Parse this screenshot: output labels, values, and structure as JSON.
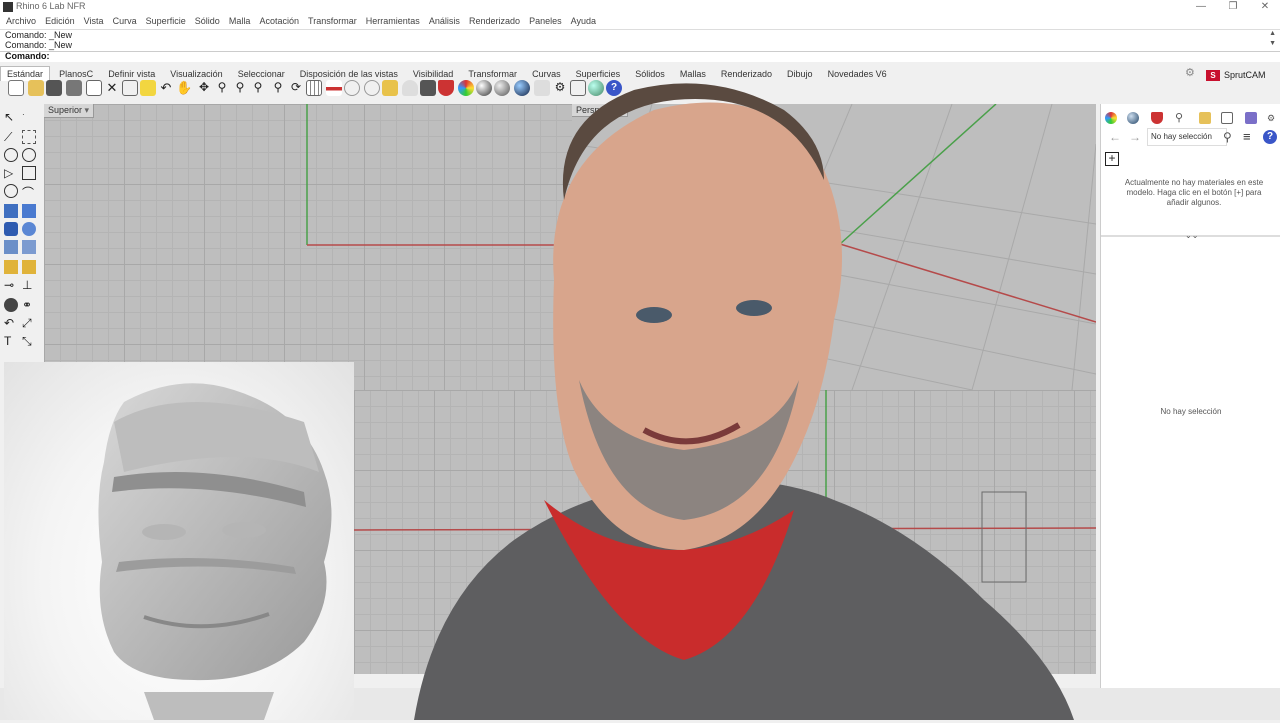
{
  "window": {
    "title": "Rhino 6 Lab NFR",
    "minimize": "—",
    "maximize": "❐",
    "close": "✕"
  },
  "menu": [
    "Archivo",
    "Edición",
    "Vista",
    "Curva",
    "Superficie",
    "Sólido",
    "Malla",
    "Acotación",
    "Transformar",
    "Herramientas",
    "Análisis",
    "Renderizado",
    "Paneles",
    "Ayuda"
  ],
  "command": {
    "history": [
      "Comando: _New",
      "Comando: _New"
    ],
    "prompt": "Comando:"
  },
  "tabs": [
    "Estándar",
    "PlanosC",
    "Definir vista",
    "Visualización",
    "Seleccionar",
    "Disposición de las vistas",
    "Visibilidad",
    "Transformar",
    "Curvas",
    "Superficies",
    "Sólidos",
    "Mallas",
    "Renderizado",
    "Dibujo",
    "Novedades V6"
  ],
  "active_tab": "Estándar",
  "sprutcam": {
    "label": "SprutCAM",
    "mark": "S"
  },
  "viewports": {
    "top": "Superior",
    "perspective": "Perspectiva"
  },
  "materials_panel": {
    "selection_field": "No hay selección",
    "add_button": "+",
    "empty_message": "Actualmente no hay materiales en este modelo. Haga clic en el botón [+] para añadir algunos.",
    "chevron": "⌄⌄",
    "no_selection": "No hay selección"
  },
  "colors": {
    "x_axis": "#b54a4a",
    "y_axis": "#4aa04a",
    "viewport_bg": "#bebebe",
    "sprut_red": "#c8102e"
  },
  "icons": [
    "new-file-icon",
    "open-folder-icon",
    "save-icon",
    "print-icon",
    "cut-icon",
    "copy-icon",
    "paste-icon",
    "undo-icon",
    "pan-hand-icon",
    "zoom-icon",
    "render-sphere-icon",
    "help-icon"
  ]
}
